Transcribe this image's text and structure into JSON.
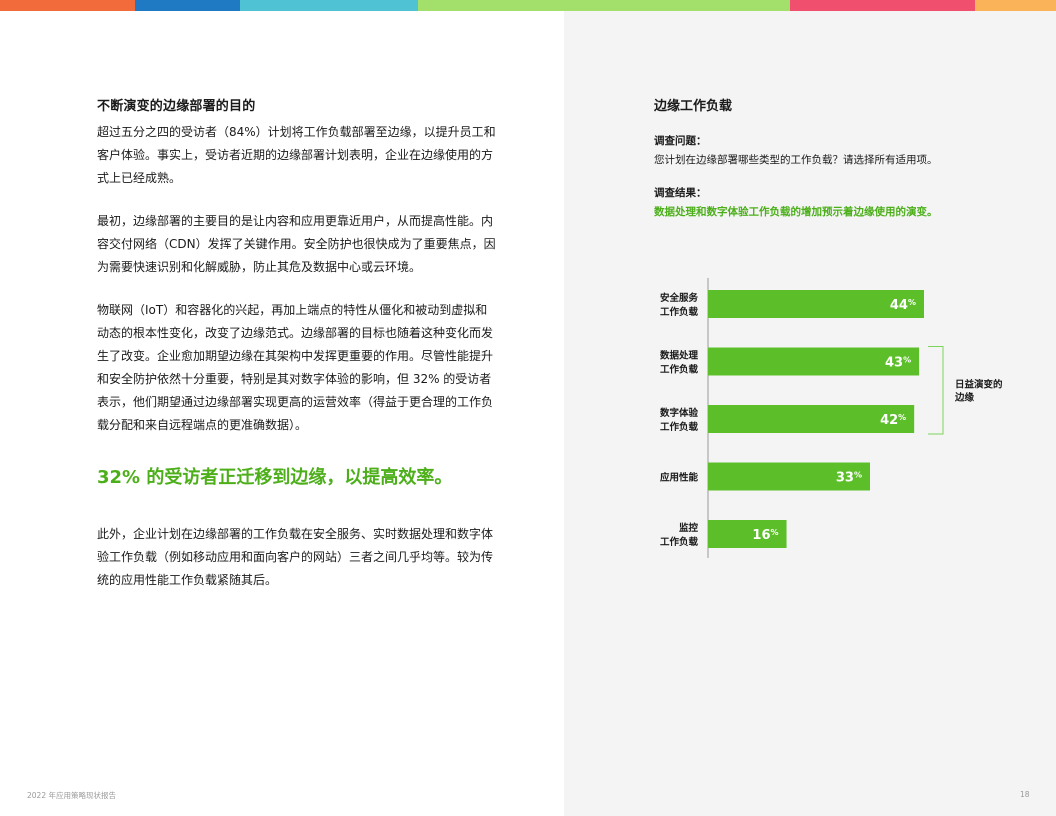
{
  "topbar_colors": [
    "#f26b3a",
    "#1f7ac3",
    "#4fc3d3",
    "#a3e06b",
    "#f0506e",
    "#fbb35a"
  ],
  "left": {
    "heading": "不断演变的边缘部署的目的",
    "para1": "超过五分之四的受访者（84%）计划将工作负载部署至边缘，以提升员工和客户体验。事实上，受访者近期的边缘部署计划表明，企业在边缘使用的方式上已经成熟。",
    "para2": "最初，边缘部署的主要目的是让内容和应用更靠近用户，从而提高性能。内容交付网络（CDN）发挥了关键作用。安全防护也很快成为了重要焦点，因为需要快速识别和化解威胁，防止其危及数据中心或云环境。",
    "para3": "物联网（IoT）和容器化的兴起，再加上端点的特性从僵化和被动到虚拟和动态的根本性变化，改变了边缘范式。边缘部署的目标也随着这种变化而发生了改变。企业愈加期望边缘在其架构中发挥更重要的作用。尽管性能提升和安全防护依然十分重要，特别是其对数字体验的影响，但 32% 的受访者表示，他们期望通过边缘部署实现更高的运营效率（得益于更合理的工作负载分配和来自远程端点的更准确数据）。",
    "highlight": "32% 的受访者正迁移到边缘，以提高效率。",
    "para4": "此外，企业计划在边缘部署的工作负载在安全服务、实时数据处理和数字体验工作负载（例如移动应用和面向客户的网站）三者之间几乎均等。较为传统的应用性能工作负载紧随其后。"
  },
  "right": {
    "title": "边缘工作负载",
    "question_label": "调查问题：",
    "question_text": "您计划在边缘部署哪些类型的工作负载？请选择所有适用项。",
    "result_label": "调查结果：",
    "result_text": "数据处理和数字体验工作负载的增加预示着边缘使用的演变。"
  },
  "chart_data": {
    "type": "bar",
    "orientation": "horizontal",
    "categories": [
      [
        "安全服务",
        "工作负载"
      ],
      [
        "数据处理",
        "工作负载"
      ],
      [
        "数字体验",
        "工作负载"
      ],
      [
        "应用性能"
      ],
      [
        "监控",
        "工作负载"
      ]
    ],
    "values": [
      44,
      43,
      42,
      33,
      16
    ],
    "value_suffix": "%",
    "bar_color": "#5cbf2a",
    "bracket_label": [
      "日益演变的",
      "边缘"
    ],
    "bracket_indices": [
      1,
      2
    ]
  },
  "footer": {
    "left": "2022 年应用策略现状报告",
    "right": "18"
  }
}
